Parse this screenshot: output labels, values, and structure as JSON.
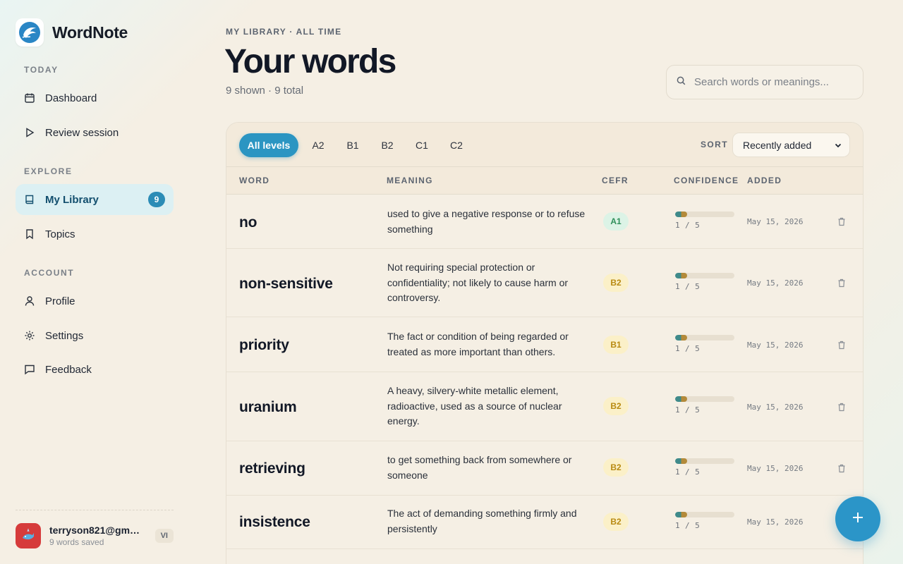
{
  "app": {
    "name": "WordNote",
    "logo_icon": "dolphin-logo-icon"
  },
  "sidebar": {
    "sections": [
      {
        "title": "TODAY",
        "items": [
          {
            "label": "Dashboard",
            "icon": "calendar-icon"
          },
          {
            "label": "Review session",
            "icon": "play-icon"
          }
        ]
      },
      {
        "title": "EXPLORE",
        "items": [
          {
            "label": "My Library",
            "icon": "book-icon",
            "badge": "9",
            "active": true
          },
          {
            "label": "Topics",
            "icon": "bookmark-icon"
          }
        ]
      },
      {
        "title": "ACCOUNT",
        "items": [
          {
            "label": "Profile",
            "icon": "user-icon"
          },
          {
            "label": "Settings",
            "icon": "gear-icon"
          },
          {
            "label": "Feedback",
            "icon": "chat-icon"
          }
        ]
      }
    ],
    "user": {
      "email": "terryson821@gmail...",
      "subtitle": "9 words saved",
      "lang": "VI"
    }
  },
  "header": {
    "breadcrumb": "MY LIBRARY · ALL TIME",
    "title": "Your words",
    "count_line": "9 shown · 9 total"
  },
  "search": {
    "placeholder": "Search words or meanings..."
  },
  "filters": {
    "levels": [
      "All levels",
      "A2",
      "B1",
      "B2",
      "C1",
      "C2"
    ],
    "active": "All levels",
    "sort_label": "SORT",
    "sort_value": "Recently added"
  },
  "table": {
    "columns": [
      "WORD",
      "MEANING",
      "CEFR",
      "CONFIDENCE",
      "ADDED"
    ],
    "rows": [
      {
        "word": "no",
        "meaning": "used to give a negative response or to refuse something",
        "cefr": "A1",
        "confidence": "1 / 5",
        "confidence_fraction": 0.2,
        "added": "May 15, 2026"
      },
      {
        "word": "non-sensitive",
        "meaning": "Not requiring special protection or confidentiality; not likely to cause harm or controversy.",
        "cefr": "B2",
        "confidence": "1 / 5",
        "confidence_fraction": 0.2,
        "added": "May 15, 2026"
      },
      {
        "word": "priority",
        "meaning": "The fact or condition of being regarded or treated as more important than others.",
        "cefr": "B1",
        "confidence": "1 / 5",
        "confidence_fraction": 0.2,
        "added": "May 15, 2026"
      },
      {
        "word": "uranium",
        "meaning": "A heavy, silvery-white metallic element, radioactive, used as a source of nuclear energy.",
        "cefr": "B2",
        "confidence": "1 / 5",
        "confidence_fraction": 0.2,
        "added": "May 15, 2026"
      },
      {
        "word": "retrieving",
        "meaning": "to get something back from somewhere or someone",
        "cefr": "B2",
        "confidence": "1 / 5",
        "confidence_fraction": 0.2,
        "added": "May 15, 2026"
      },
      {
        "word": "insistence",
        "meaning": "The act of demanding something firmly and persistently",
        "cefr": "B2",
        "confidence": "1 / 5",
        "confidence_fraction": 0.2,
        "added": "May 15, 2026"
      }
    ]
  },
  "colors": {
    "accent": "#2b95c2",
    "cefr_a1": "#dcf3e6",
    "cefr_b": "#fbf0c8"
  }
}
